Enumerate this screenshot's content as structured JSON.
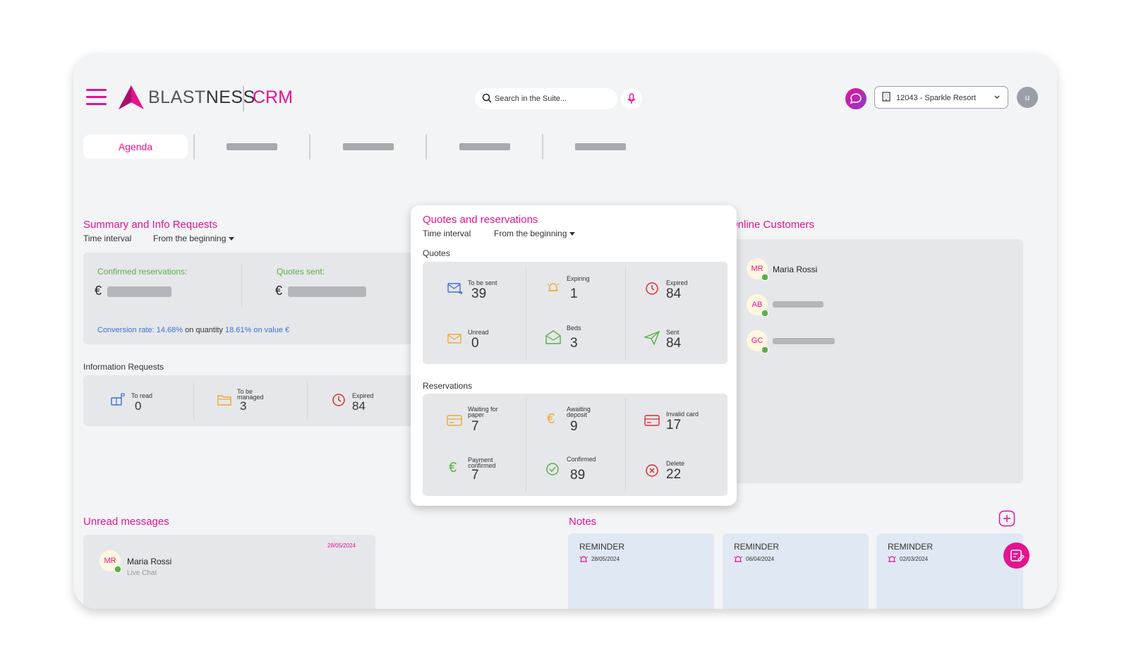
{
  "header": {
    "logo_text_light": "BLAST",
    "logo_text_bold": "NESS",
    "app_name": "CRM",
    "search_placeholder": "Search in the Suite...",
    "property_label": "12043 - Sparkle Resort",
    "user_initial": "u"
  },
  "tabs": {
    "active_label": "Agenda"
  },
  "summary": {
    "title": "Summary and Info Requests",
    "interval_label": "Time interval",
    "interval_value": "From the beginning",
    "confirmed_label": "Confirmed reservations:",
    "quotes_sent_label": "Quotes sent:",
    "currency": "€",
    "conv_prefix": "Conversion rate: ",
    "conv_qty": "14.68%",
    "conv_mid": " on quantity ",
    "conv_val": "18.61% on value €"
  },
  "info_requests": {
    "title": "Information Requests",
    "items": [
      {
        "label": "To read",
        "value": "0"
      },
      {
        "label": "To be managed",
        "value": "3"
      },
      {
        "label": "Expired",
        "value": "84"
      }
    ]
  },
  "quotes_popup": {
    "title": "Quotes and reservations",
    "interval_label": "Time interval",
    "interval_value": "From the beginning",
    "quotes_title": "Quotes",
    "quotes": [
      {
        "label": "To be sent",
        "value": "39",
        "icon": "mail-send-icon"
      },
      {
        "label": "Expiring",
        "value": "1",
        "icon": "bell-icon"
      },
      {
        "label": "Expired",
        "value": "84",
        "icon": "clock-icon"
      },
      {
        "label": "Unread",
        "value": "0",
        "icon": "envelope-icon"
      },
      {
        "label": "Beds",
        "value": "3",
        "icon": "open-envelope-icon"
      },
      {
        "label": "Sent",
        "value": "84",
        "icon": "paper-plane-icon"
      }
    ],
    "reservations_title": "Reservations",
    "reservations": [
      {
        "label": "Waiting for paper",
        "value": "7",
        "icon": "card-icon"
      },
      {
        "label": "Awaiting deposit",
        "value": "9",
        "icon": "euro-icon"
      },
      {
        "label": "Invalid card",
        "value": "17",
        "icon": "credit-card-icon"
      },
      {
        "label": "Payment confirmed",
        "value": "7",
        "icon": "euro-icon"
      },
      {
        "label": "Confirmed",
        "value": "89",
        "icon": "check-circle-icon"
      },
      {
        "label": "Delete",
        "value": "22",
        "icon": "x-circle-icon"
      }
    ]
  },
  "online": {
    "title": "Online Customers",
    "customers": [
      {
        "initials": "MR",
        "name": "Maria Rossi"
      },
      {
        "initials": "AB",
        "name": ""
      },
      {
        "initials": "GC",
        "name": ""
      }
    ]
  },
  "unread": {
    "title": "Unread messages",
    "message": {
      "initials": "MR",
      "name": "Maria Rossi",
      "source": "Live Chat",
      "date": "28/05/2024"
    }
  },
  "notes": {
    "title": "Notes",
    "items": [
      {
        "title": "REMINDER",
        "date": "28/05/2024"
      },
      {
        "title": "REMINDER",
        "date": "06/04/2024"
      },
      {
        "title": "REMINDER",
        "date": "02/03/2024"
      }
    ]
  },
  "colors": {
    "accent": "#e3148f",
    "green": "#5ab043",
    "blue": "#3b6fd6",
    "orange": "#f0a830",
    "red": "#d32f2f"
  }
}
